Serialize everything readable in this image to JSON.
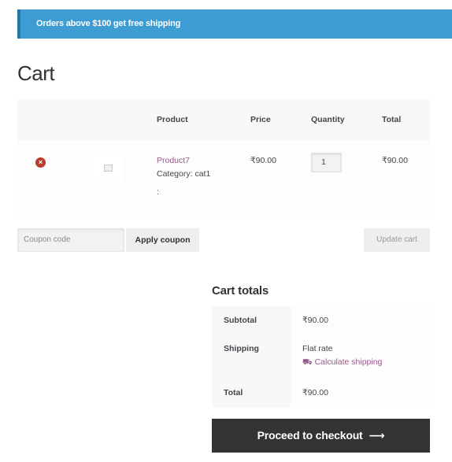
{
  "notice": {
    "text": "Orders above $100 get free shipping"
  },
  "page": {
    "title": "Cart"
  },
  "cart": {
    "headers": {
      "product": "Product",
      "price": "Price",
      "quantity": "Quantity",
      "total": "Total"
    },
    "items": [
      {
        "remove_icon": "remove-circle-icon",
        "thumbnail_icon": "image-placeholder-icon",
        "name": "Product7",
        "category": "Category: cat1",
        "meta": ":",
        "price": "₹90.00",
        "quantity": "1",
        "total": "₹90.00"
      }
    ]
  },
  "coupon": {
    "placeholder": "Coupon code",
    "apply_label": "Apply coupon"
  },
  "update_label": "Update cart",
  "totals": {
    "title": "Cart totals",
    "subtotal_label": "Subtotal",
    "subtotal_value": "₹90.00",
    "shipping_label": "Shipping",
    "shipping_method": "Flat rate",
    "calculate_label": "Calculate shipping",
    "total_label": "Total",
    "total_value": "₹90.00"
  },
  "checkout": {
    "label": "Proceed to checkout",
    "arrow": "⟶"
  },
  "colors": {
    "notice": "#3d9cd2",
    "link": "#96588a",
    "checkout": "#333333",
    "remove": "#bb3c2b"
  }
}
